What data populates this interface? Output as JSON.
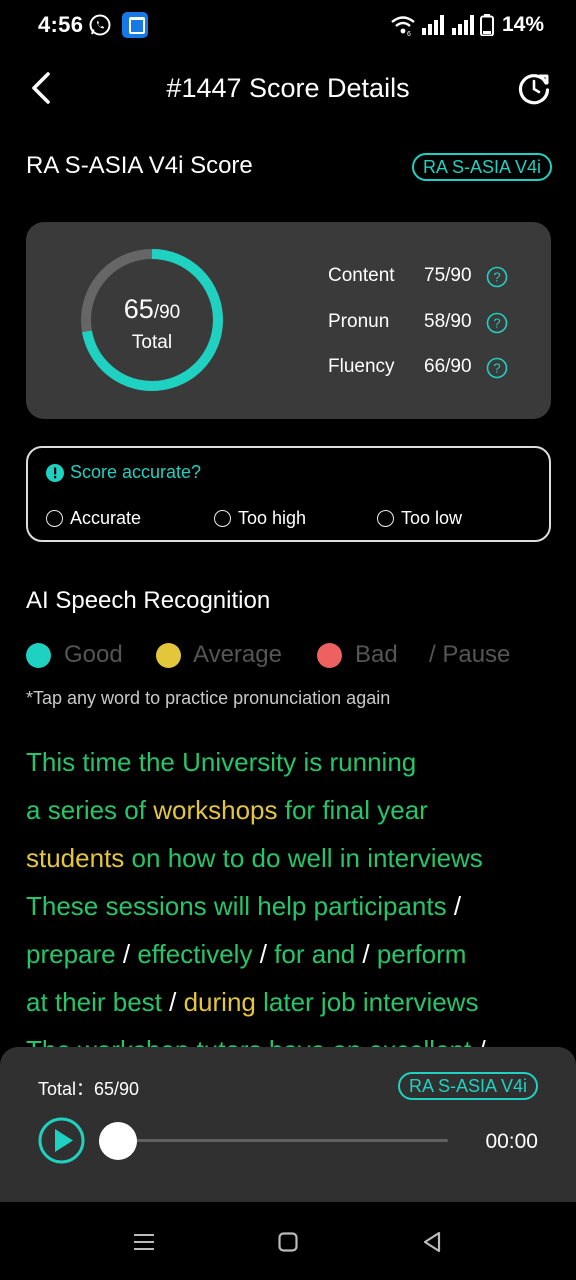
{
  "status": {
    "time": "4:56",
    "battery": "14%"
  },
  "header": {
    "title": "#1447 Score Details"
  },
  "score": {
    "name": "RA S-ASIA V4i Score",
    "badge": "RA S-ASIA V4i",
    "total_value": "65",
    "total_of": "/90",
    "total_label": "Total",
    "progress": 0.722,
    "ring_color": "#1fd1c1",
    "metrics": [
      {
        "name": "Content",
        "value": "75/90"
      },
      {
        "name": "Pronun",
        "value": "58/90"
      },
      {
        "name": "Fluency",
        "value": "66/90"
      }
    ]
  },
  "feedback": {
    "question": "Score accurate?",
    "options": [
      "Accurate",
      "Too high",
      "Too low"
    ]
  },
  "ai": {
    "title": "AI Speech Recognition",
    "legend": {
      "good": "Good",
      "average": "Average",
      "bad": "Bad",
      "pause": "/ Pause"
    },
    "colors": {
      "good": "#25c56a",
      "average": "#e3c63a",
      "bad": "#ef6160",
      "legend_good": "#1fd1c1"
    },
    "hint": "*Tap any word to practice pronunciation again",
    "passage": [
      [
        [
          "This",
          "g"
        ],
        [
          "time",
          "g"
        ],
        [
          "the",
          "g"
        ],
        [
          "University",
          "g"
        ],
        [
          "is",
          "g"
        ],
        [
          "running",
          "g"
        ]
      ],
      [
        [
          "a",
          "g"
        ],
        [
          "series",
          "g"
        ],
        [
          "of",
          "g"
        ],
        [
          "workshops",
          "a"
        ],
        [
          "for",
          "g"
        ],
        [
          "final",
          "g"
        ],
        [
          "year",
          "g"
        ]
      ],
      [
        [
          "students",
          "a"
        ],
        [
          "on",
          "g"
        ],
        [
          "how",
          "g"
        ],
        [
          "to",
          "g"
        ],
        [
          "do",
          "g"
        ],
        [
          "well",
          "g"
        ],
        [
          "in",
          "g"
        ],
        [
          "interviews",
          "g"
        ]
      ],
      [
        [
          "These",
          "g"
        ],
        [
          "sessions",
          "g"
        ],
        [
          "will",
          "g"
        ],
        [
          "help",
          "g"
        ],
        [
          "participants",
          "g"
        ],
        [
          "/",
          "p"
        ]
      ],
      [
        [
          "prepare",
          "g"
        ],
        [
          "/",
          "p"
        ],
        [
          "effectively",
          "g"
        ],
        [
          "/",
          "p"
        ],
        [
          "for",
          "g"
        ],
        [
          "and",
          "g"
        ],
        [
          "/",
          "p"
        ],
        [
          "perform",
          "g"
        ]
      ],
      [
        [
          "at",
          "g"
        ],
        [
          "their",
          "g"
        ],
        [
          "best",
          "g"
        ],
        [
          "/",
          "p"
        ],
        [
          "during",
          "a"
        ],
        [
          "later",
          "g"
        ],
        [
          "job",
          "g"
        ],
        [
          "interviews",
          "g"
        ]
      ],
      [
        [
          "The",
          "g"
        ],
        [
          "workshop",
          "g"
        ],
        [
          "tutors",
          "g"
        ],
        [
          "have",
          "g"
        ],
        [
          "an",
          "g"
        ],
        [
          "excellent",
          "g"
        ],
        [
          "/",
          "p"
        ]
      ]
    ]
  },
  "player": {
    "total": "Total：65/90",
    "badge": "RA S-ASIA V4i",
    "time": "00:00"
  }
}
